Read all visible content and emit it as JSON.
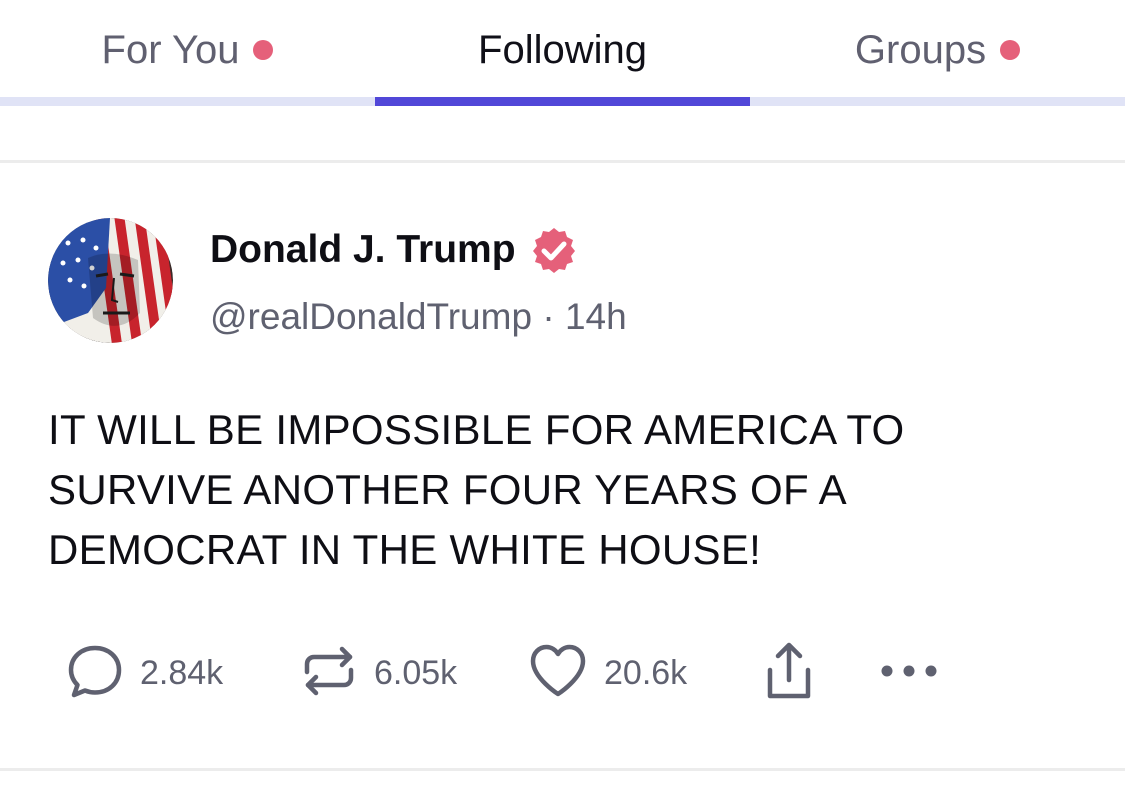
{
  "tabs": [
    {
      "label": "For You",
      "active": false,
      "has_dot": true
    },
    {
      "label": "Following",
      "active": true,
      "has_dot": false
    },
    {
      "label": "Groups",
      "active": false,
      "has_dot": true
    }
  ],
  "colors": {
    "accent": "#5147d8",
    "notification_dot": "#e5607a",
    "verified_badge": "#e5607a",
    "tab_track": "#e0e3f6"
  },
  "post": {
    "author": {
      "name": "Donald J. Trump",
      "verified_icon": "verified-badge-icon",
      "avatar_icon": "profile-avatar"
    },
    "handle": "@realDonaldTrump",
    "separator": "·",
    "time": "14h",
    "body_lines": [
      "IT WILL BE IMPOSSIBLE FOR AMERICA TO",
      "SURVIVE ANOTHER FOUR YEARS OF A",
      "DEMOCRAT IN THE WHITE HOUSE!"
    ],
    "actions": {
      "reply": {
        "icon": "reply-icon",
        "count": "2.84k"
      },
      "retruth": {
        "icon": "retruth-icon",
        "count": "6.05k"
      },
      "like": {
        "icon": "heart-icon",
        "count": "20.6k"
      },
      "share": {
        "icon": "share-icon"
      },
      "more": {
        "icon": "more-icon"
      }
    }
  }
}
